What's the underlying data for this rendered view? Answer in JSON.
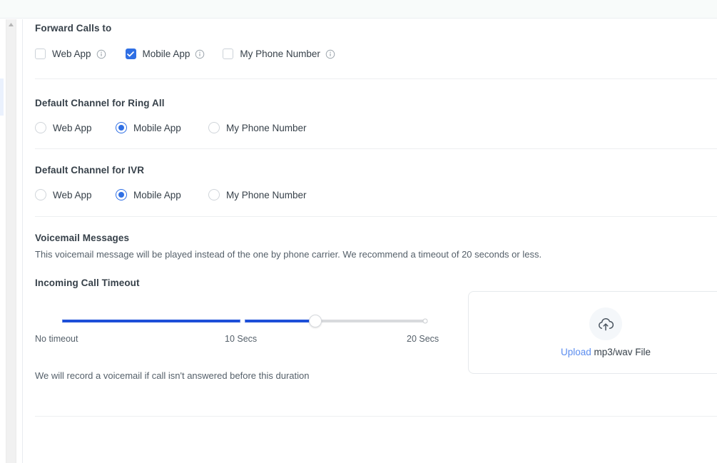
{
  "theme": {
    "accent": "#2f6fe4",
    "slider_fill": "#1d4fd8",
    "slider_track": "#d8dadd",
    "link": "#5b8def",
    "text": "#37414a",
    "muted_text": "#55606a",
    "divider": "#edeff1"
  },
  "scrollbar": {
    "up_arrow_icon": "caret-up-icon"
  },
  "sections": {
    "forward_calls": {
      "title": "Forward Calls to",
      "type": "checkbox",
      "options": [
        {
          "label": "Web App",
          "checked": false,
          "info": true
        },
        {
          "label": "Mobile App",
          "checked": true,
          "info": true
        },
        {
          "label": "My Phone Number",
          "checked": false,
          "info": true
        }
      ]
    },
    "default_channel_ring_all": {
      "title": "Default Channel for Ring All",
      "type": "radio",
      "options": [
        {
          "label": "Web App",
          "selected": false
        },
        {
          "label": "Mobile App",
          "selected": true
        },
        {
          "label": "My Phone Number",
          "selected": false
        }
      ]
    },
    "default_channel_ivr": {
      "title": "Default Channel for IVR",
      "type": "radio",
      "options": [
        {
          "label": "Web App",
          "selected": false
        },
        {
          "label": "Mobile App",
          "selected": true
        },
        {
          "label": "My Phone Number",
          "selected": false
        }
      ]
    },
    "voicemail": {
      "title": "Voicemail Messages",
      "description": "This voicemail message will be played instead of the one by phone carrier. We recommend a timeout of 20 seconds or less."
    },
    "incoming_call_timeout": {
      "title": "Incoming Call Timeout",
      "footnote": "We will record a voicemail if call isn't answered before this duration",
      "slider": {
        "min_label": "No timeout",
        "mid_label": "10 Secs",
        "max_label": "20 Secs",
        "min_value": 0,
        "max_value": 20,
        "current_value": 14,
        "fill_percent": 70
      }
    },
    "upload": {
      "icon": "cloud-upload-icon",
      "link_text": "Upload",
      "rest_text": "mp3/wav File"
    }
  }
}
